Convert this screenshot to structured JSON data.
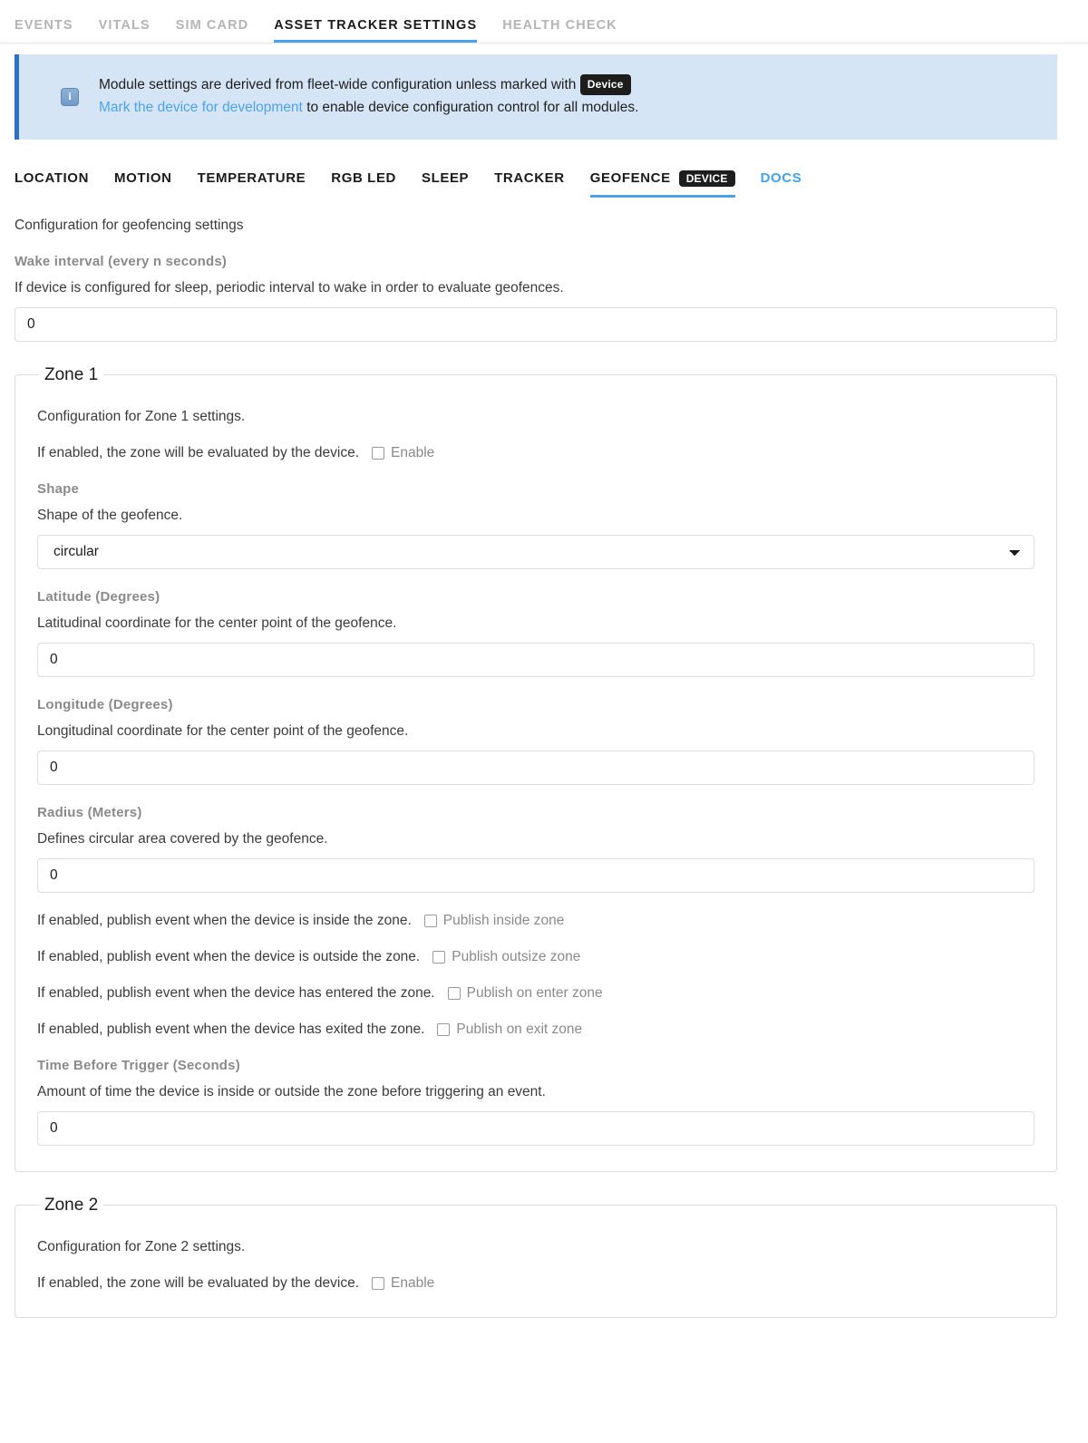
{
  "topnav": {
    "items": [
      {
        "label": "EVENTS",
        "active": false
      },
      {
        "label": "VITALS",
        "active": false
      },
      {
        "label": "SIM CARD",
        "active": false
      },
      {
        "label": "ASSET TRACKER SETTINGS",
        "active": true
      },
      {
        "label": "HEALTH CHECK",
        "active": false
      }
    ]
  },
  "banner": {
    "icon": "info-icon",
    "line1_before": "Module settings are derived from fleet-wide configuration unless marked with",
    "badge": "Device",
    "link": "Mark the device for development",
    "line2_after": "to enable device configuration control for all modules."
  },
  "modnav": {
    "items": [
      {
        "label": "LOCATION"
      },
      {
        "label": "MOTION"
      },
      {
        "label": "TEMPERATURE"
      },
      {
        "label": "RGB LED"
      },
      {
        "label": "SLEEP"
      },
      {
        "label": "TRACKER"
      },
      {
        "label": "GEOFENCE",
        "badge": "Device"
      },
      {
        "label": "DOCS"
      }
    ]
  },
  "page": {
    "description": "Configuration for geofencing settings",
    "wake_interval": {
      "label": "Wake interval (every n seconds)",
      "help": "If device is configured for sleep, periodic interval to wake in order to evaluate geofences.",
      "value": "0"
    }
  },
  "zone1": {
    "legend": "Zone 1",
    "description": "Configuration for Zone 1 settings.",
    "enable": {
      "text": "If enabled, the zone will be evaluated by the device.",
      "checkbox_label": "Enable",
      "checked": false
    },
    "shape": {
      "label": "Shape",
      "help": "Shape of the geofence.",
      "value": "circular",
      "options": [
        "circular"
      ]
    },
    "latitude": {
      "label": "Latitude (Degrees)",
      "help": "Latitudinal coordinate for the center point of the geofence.",
      "value": "0"
    },
    "longitude": {
      "label": "Longitude (Degrees)",
      "help": "Longitudinal coordinate for the center point of the geofence.",
      "value": "0"
    },
    "radius": {
      "label": "Radius (Meters)",
      "help": "Defines circular area covered by the geofence.",
      "value": "0"
    },
    "publish_inside": {
      "text": "If enabled, publish event when the device is inside the zone.",
      "checkbox_label": "Publish inside zone",
      "checked": false
    },
    "publish_outside": {
      "text": "If enabled, publish event when the device is outside the zone.",
      "checkbox_label": "Publish outsize zone",
      "checked": false
    },
    "publish_enter": {
      "text": "If enabled, publish event when the device has entered the zone.",
      "checkbox_label": "Publish on enter zone",
      "checked": false
    },
    "publish_exit": {
      "text": "If enabled, publish event when the device has exited the zone.",
      "checkbox_label": "Publish on exit zone",
      "checked": false
    },
    "trigger_time": {
      "label": "Time Before Trigger (Seconds)",
      "help": "Amount of time the device is inside or outside the zone before triggering an event.",
      "value": "0"
    }
  },
  "zone2": {
    "legend": "Zone 2",
    "description": "Configuration for Zone 2 settings.",
    "enable": {
      "text": "If enabled, the zone will be evaluated by the device.",
      "checkbox_label": "Enable",
      "checked": false
    }
  },
  "colors": {
    "accent": "#4aa3e8",
    "banner_bg": "#d6e5f5",
    "banner_border": "#2f6fc6",
    "badge_bg": "#1d1d1d",
    "label_grey": "#8a8a8a"
  }
}
